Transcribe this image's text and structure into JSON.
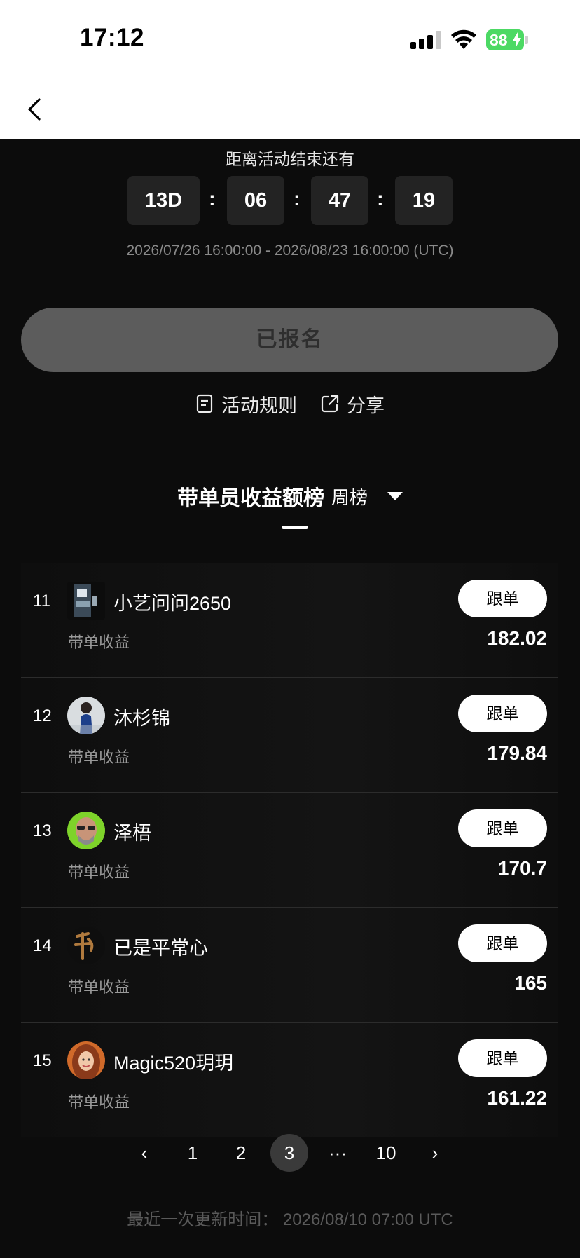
{
  "status_bar": {
    "time": "17:12",
    "battery": "88"
  },
  "countdown": {
    "label": "距离活动结束还有",
    "days": "13D",
    "hours": "06",
    "minutes": "47",
    "seconds": "19",
    "separator": ":",
    "date_range": "2026/07/26 16:00:00 - 2026/08/23 16:00:00 (UTC)"
  },
  "enroll_button": {
    "label": "已报名"
  },
  "links": {
    "rules": "活动规则",
    "share": "分享"
  },
  "leaderboard": {
    "title": "带单员收益额榜",
    "period": "周榜",
    "follow_label": "跟单",
    "earnings_label": "带单收益",
    "rows": [
      {
        "rank": "11",
        "name": "小艺问问2650",
        "earnings": "182.02"
      },
      {
        "rank": "12",
        "name": "沐杉锦",
        "earnings": "179.84"
      },
      {
        "rank": "13",
        "name": "泽梧",
        "earnings": "170.7"
      },
      {
        "rank": "14",
        "name": "已是平常心",
        "earnings": "165"
      },
      {
        "rank": "15",
        "name": "Magic520玥玥",
        "earnings": "161.22"
      }
    ]
  },
  "pagination": {
    "prev": "‹",
    "pages": [
      "1",
      "2",
      "3",
      "···",
      "10"
    ],
    "current": "3",
    "next": "›"
  },
  "last_update": "最近一次更新时间： 2026/08/10 07:00 UTC"
}
